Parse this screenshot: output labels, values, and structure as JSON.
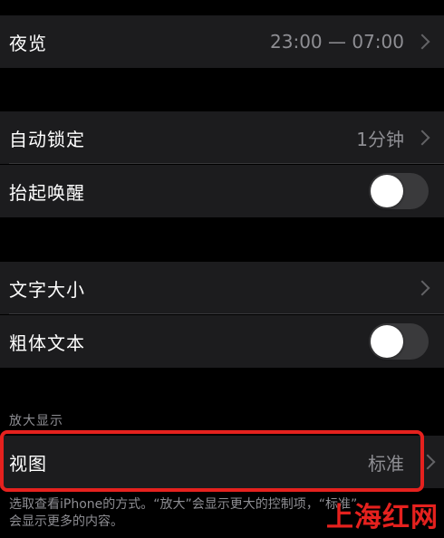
{
  "night_shift": {
    "label": "夜览",
    "value": "23:00 — 07:00"
  },
  "auto_lock": {
    "label": "自动锁定",
    "value": "1分钟"
  },
  "raise_to_wake": {
    "label": "抬起唤醒",
    "enabled": false
  },
  "text_size": {
    "label": "文字大小"
  },
  "bold_text": {
    "label": "粗体文本",
    "enabled": false
  },
  "display_zoom": {
    "header": "放大显示",
    "view_label": "视图",
    "view_value": "标准",
    "footer_line1": "选取查看iPhone的方式。“放大”会显示更大的控制项，“标准”",
    "footer_line2": "会显示更多的内容。"
  },
  "watermark": {
    "text": "上海红网"
  },
  "colors": {
    "background": "#000000",
    "cell": "#1c1c1e",
    "secondary_text": "#8e8e93",
    "highlight": "#e5211e"
  },
  "icons": [
    "chevron-right-icon"
  ]
}
